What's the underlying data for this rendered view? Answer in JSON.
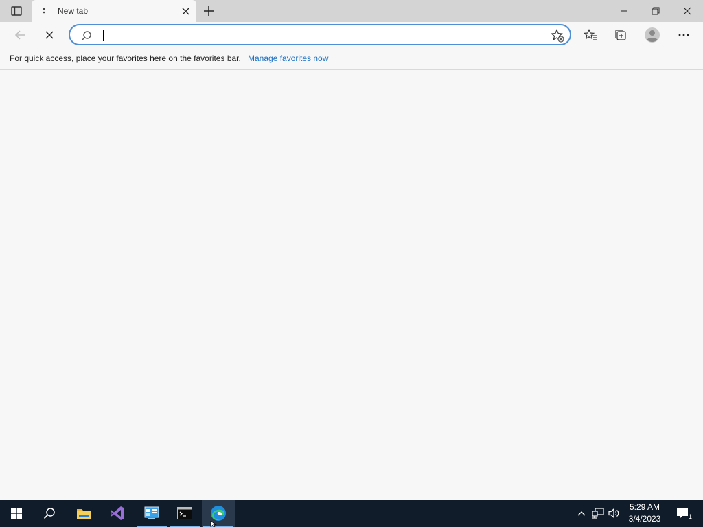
{
  "browser": {
    "tab": {
      "title": "New tab"
    },
    "address_bar": {
      "value": "",
      "placeholder": ""
    },
    "favorites_bar": {
      "message": "For quick access, place your favorites here on the favorites bar.",
      "link": "Manage favorites now"
    }
  },
  "icons": {
    "tab_actions": "tab-actions-icon",
    "tab_loading": "loading-icon",
    "tab_close": "close-icon",
    "new_tab": "plus-icon",
    "minimize": "minimize-icon",
    "restore": "restore-icon",
    "close_window": "close-icon",
    "back": "back-arrow-icon",
    "stop": "stop-icon",
    "search": "search-icon",
    "add_favorite": "star-plus-icon",
    "favorites": "favorites-icon",
    "collections": "collections-icon",
    "profile": "profile-icon",
    "menu": "more-icon"
  },
  "taskbar": {
    "apps": [
      "start",
      "search",
      "file-explorer",
      "visual-studio",
      "control-panel",
      "terminal",
      "edge"
    ],
    "clock": {
      "time": "5:29 AM",
      "date": "3/4/2023"
    },
    "notifications": {
      "count": "1"
    }
  },
  "colors": {
    "accent": "#4e8fd6",
    "link": "#1a6fc2",
    "taskbar": "#101c2a",
    "titlebar": "#d4d4d4"
  }
}
